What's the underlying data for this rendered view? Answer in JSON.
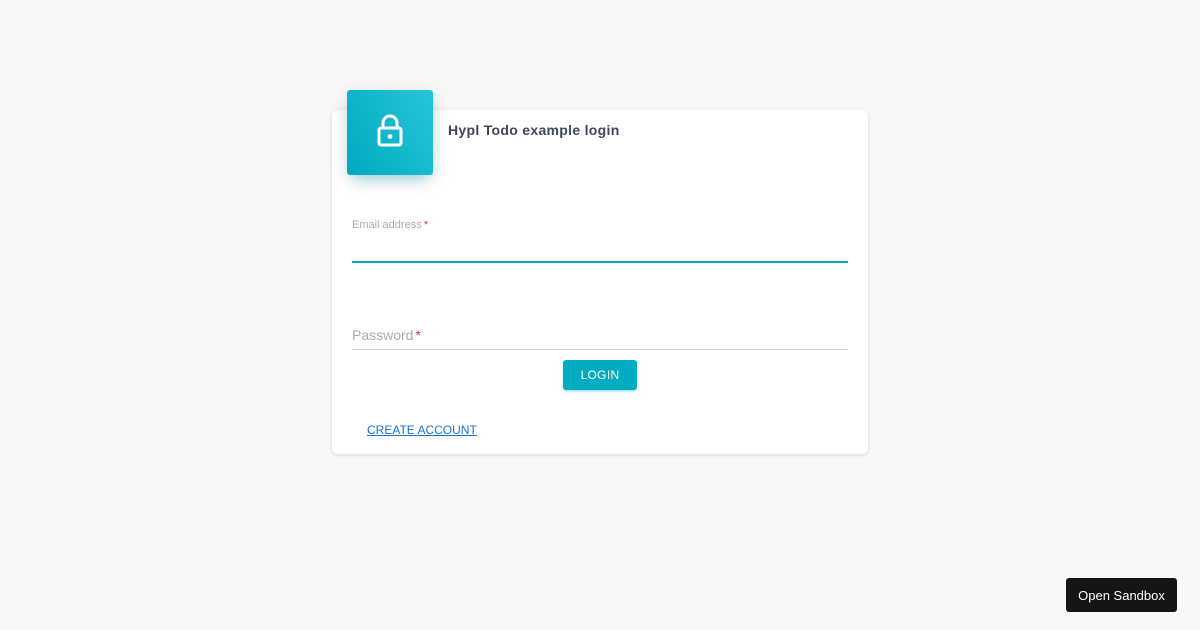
{
  "login_card": {
    "title": "Hypl Todo example login",
    "header_icon": "lock-icon",
    "accent_color": "#00acc1"
  },
  "email": {
    "label": "Email address",
    "required_marker": "*",
    "value": ""
  },
  "password": {
    "label": "Password",
    "required_marker": "*",
    "value": ""
  },
  "actions": {
    "login_label": "LOGIN",
    "create_account_label": "CREATE ACCOUNT"
  },
  "sandbox": {
    "label": "Open Sandbox"
  }
}
